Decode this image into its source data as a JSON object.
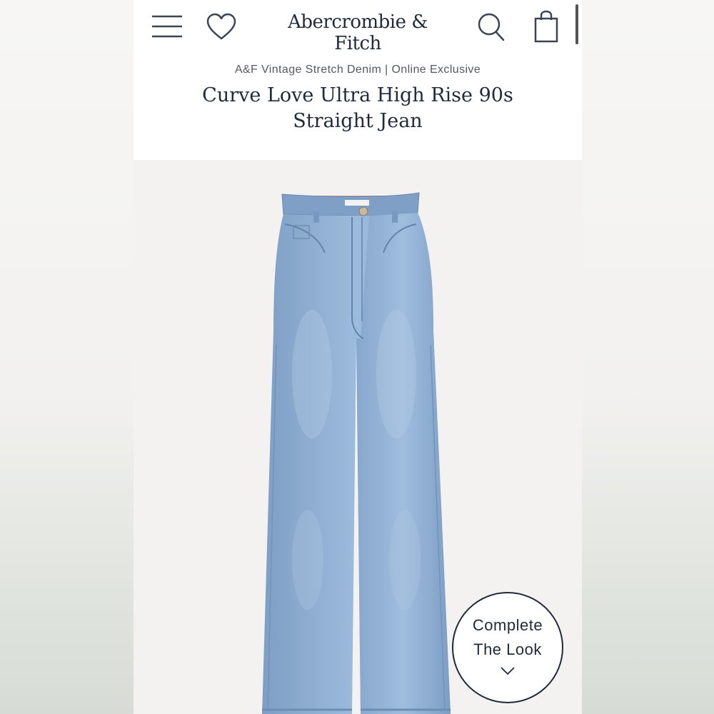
{
  "header": {
    "logo": "Abercrombie & Fitch"
  },
  "product": {
    "subtitle": "A&F Vintage Stretch Denim | Online Exclusive",
    "title": "Curve Love Ultra High Rise 90s Straight Jean"
  },
  "complete_look": {
    "line1": "Complete",
    "line2": "The Look"
  },
  "icons": {
    "menu": "menu-icon",
    "wishlist": "heart-icon",
    "search": "search-icon",
    "bag": "bag-icon",
    "expand": "chevron-down-icon"
  },
  "colors": {
    "brand_text": "#1f2a3a",
    "denim": "#8fb0d4",
    "background": "#f4f2f0"
  }
}
